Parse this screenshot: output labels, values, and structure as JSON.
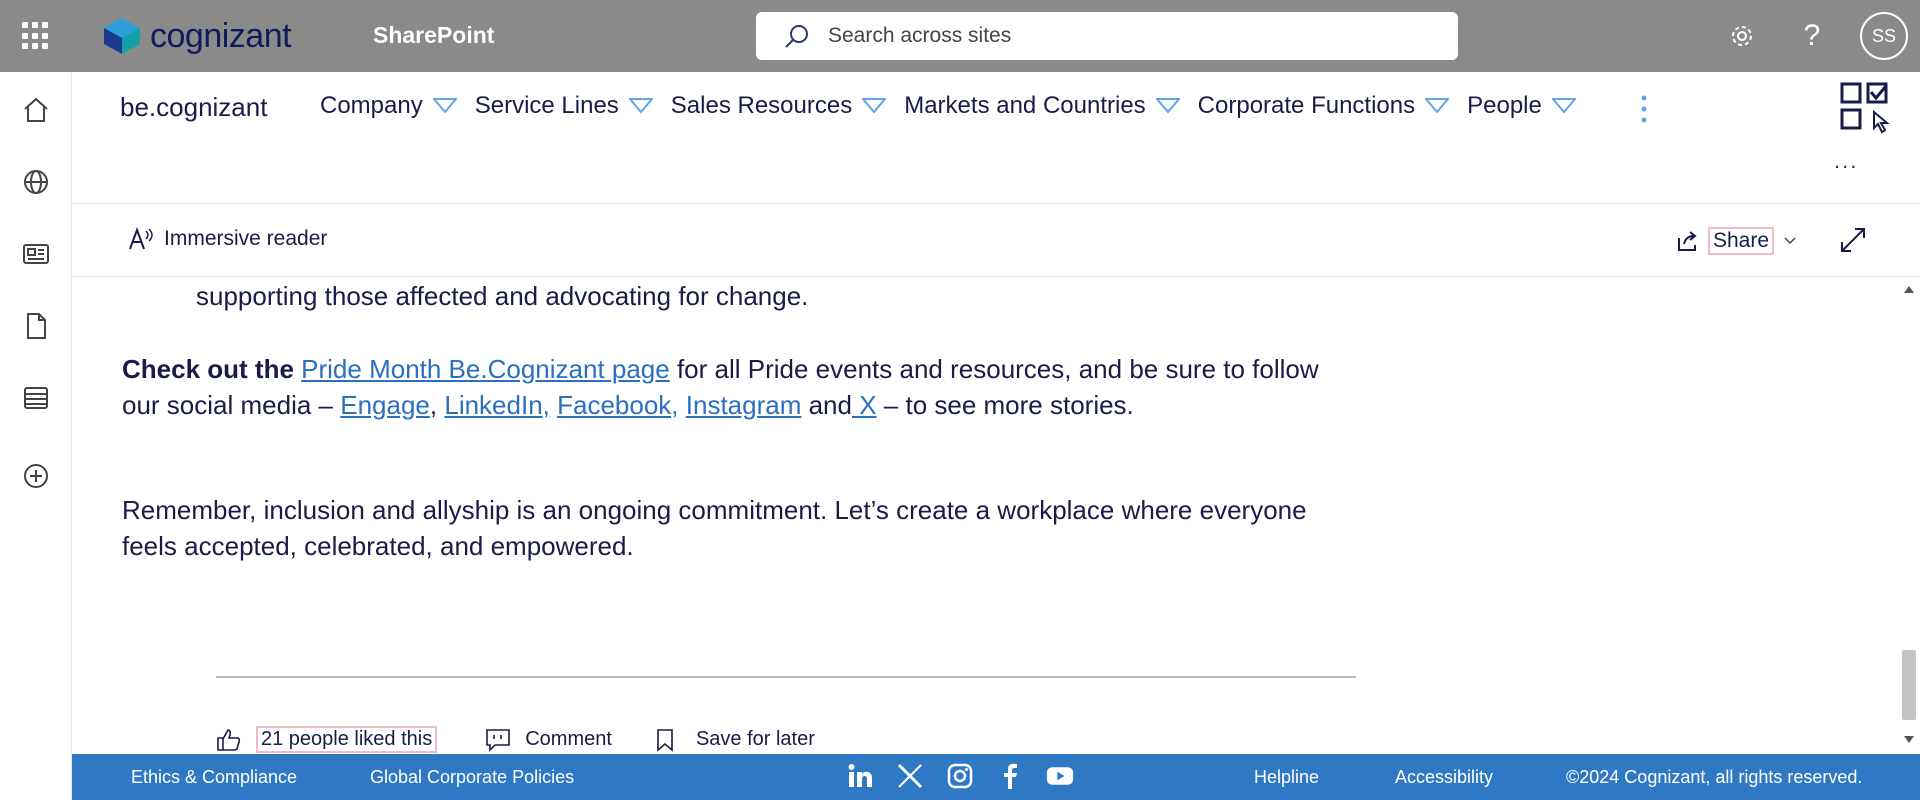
{
  "suite": {
    "logo_text": "cognizant",
    "app_name": "SharePoint",
    "search_placeholder": "Search across sites",
    "avatar_initials": "SS",
    "help_glyph": "?",
    "icons": [
      "waffle-icon",
      "search-icon",
      "gear-icon",
      "help-icon"
    ]
  },
  "leftrail": {
    "items": [
      "home-icon",
      "globe-icon",
      "news-icon",
      "file-icon",
      "list-icon",
      "add-icon"
    ]
  },
  "hubnav": {
    "site_title": "be.cognizant",
    "items": [
      {
        "label": "Company"
      },
      {
        "label": "Service Lines"
      },
      {
        "label": "Sales Resources"
      },
      {
        "label": "Markets and Countries"
      },
      {
        "label": "Corporate Functions"
      },
      {
        "label": "People"
      }
    ],
    "ellipsis": "..."
  },
  "commandbar": {
    "immersive_reader": "Immersive reader",
    "share": "Share"
  },
  "content": {
    "para0": "supporting those affected and advocating for change.",
    "para1": {
      "bold": "Check out the",
      "link_pride": "Pride Month Be.Cognizant page",
      "text1": " for all Pride events and resources, and be sure to follow our social media – ",
      "link_engage": "Engage",
      "comma1": ",",
      "link_linkedin": "LinkedIn,",
      "link_facebook": "Facebook,",
      "link_instagram": "Instagram",
      "and_text": " and",
      "link_x": " X",
      "text2": " – to see more stories."
    },
    "para2": "Remember, inclusion and allyship is an ongoing commitment. Let’s create a workplace where everyone feels accepted, celebrated, and empowered.",
    "social": {
      "likes": "21 people liked this",
      "comment": "Comment",
      "save": "Save for later"
    }
  },
  "footer": {
    "ethics": "Ethics & Compliance",
    "policies": "Global Corporate Policies",
    "social_icons": [
      "linkedin-icon",
      "x-icon",
      "instagram-icon",
      "facebook-icon",
      "youtube-icon"
    ],
    "helpline": "Helpline",
    "accessibility": "Accessibility",
    "copyright": "©2024 Cognizant, all rights reserved."
  },
  "colors": {
    "suitebar": "#8a8a8a",
    "footer": "#2f79c4",
    "link": "#2b6fbf",
    "text": "#1b1b4a",
    "highlight_border": "#f4b8c8"
  }
}
